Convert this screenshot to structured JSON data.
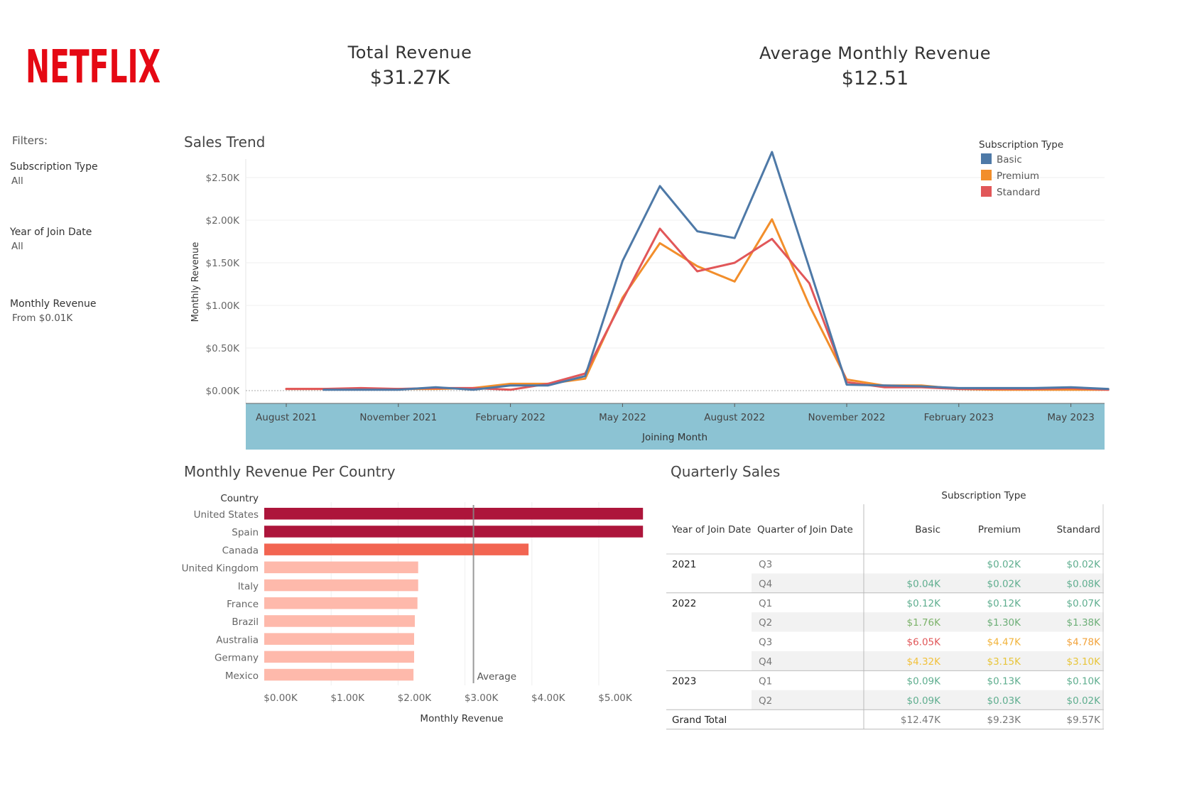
{
  "brand": {
    "logo_text": "NETFLIX",
    "color": "#e50914"
  },
  "kpis": [
    {
      "title": "Total Revenue",
      "value": "$31.27K"
    },
    {
      "title": "Average Monthly Revenue",
      "value": "$12.51"
    }
  ],
  "filters": {
    "heading": "Filters:",
    "items": [
      {
        "name": "Subscription Type",
        "value": "All"
      },
      {
        "name": "Year of Join Date",
        "value": "All"
      },
      {
        "name": "Monthly Revenue",
        "value": "From $0.01K"
      }
    ]
  },
  "colors": {
    "basic": "#4e79a7",
    "premium": "#f28e2b",
    "standard": "#e15759",
    "axis_band": "#8cc3d3"
  },
  "chart_data": [
    {
      "type": "line",
      "title": "Sales Trend",
      "xlabel": "Joining Month",
      "ylabel": "Monthly Revenue",
      "ylim": [
        0,
        2750
      ],
      "yticks": [
        0,
        500,
        1000,
        1500,
        2000,
        2500
      ],
      "ytick_labels": [
        "$0.00K",
        "$0.50K",
        "$1.00K",
        "$1.50K",
        "$2.00K",
        "$2.50K"
      ],
      "xtick_labels": [
        "August 2021",
        "November 2021",
        "February 2022",
        "May 2022",
        "August 2022",
        "November 2022",
        "February 2023",
        "May 2023"
      ],
      "xtick_months": [
        "2021-08",
        "2021-11",
        "2022-02",
        "2022-05",
        "2022-08",
        "2022-11",
        "2023-02",
        "2023-05"
      ],
      "legend_title": "Subscription Type",
      "legend_position": "top-right",
      "x": [
        "2021-08",
        "2021-09",
        "2021-10",
        "2021-11",
        "2021-12",
        "2022-01",
        "2022-02",
        "2022-03",
        "2022-04",
        "2022-05",
        "2022-06",
        "2022-07",
        "2022-08",
        "2022-09",
        "2022-10",
        "2022-11",
        "2022-12",
        "2023-01",
        "2023-02",
        "2023-03",
        "2023-04",
        "2023-05",
        "2023-06"
      ],
      "series": [
        {
          "name": "Basic",
          "color": "#4e79a7",
          "values": [
            null,
            10,
            10,
            10,
            40,
            10,
            60,
            60,
            170,
            1520,
            2400,
            1870,
            1790,
            2800,
            1440,
            70,
            60,
            50,
            30,
            30,
            30,
            40,
            20
          ]
        },
        {
          "name": "Premium",
          "color": "#f28e2b",
          "values": [
            20,
            20,
            20,
            20,
            20,
            30,
            80,
            80,
            140,
            1090,
            1730,
            1460,
            1280,
            2010,
            1000,
            130,
            60,
            60,
            20,
            10,
            10,
            10,
            10
          ]
        },
        {
          "name": "Standard",
          "color": "#e15759",
          "values": [
            20,
            20,
            30,
            20,
            30,
            30,
            10,
            80,
            200,
            1060,
            1900,
            1400,
            1500,
            1780,
            1260,
            100,
            40,
            40,
            20,
            20,
            20,
            30,
            10
          ]
        }
      ]
    },
    {
      "type": "bar",
      "orientation": "horizontal",
      "title": "Monthly Revenue Per Country",
      "ylabel": "Country",
      "xlabel": "Monthly Revenue",
      "xlim": [
        0,
        5800
      ],
      "xticks": [
        0,
        1000,
        2000,
        3000,
        4000,
        5000
      ],
      "xtick_labels": [
        "$0.00K",
        "$1.00K",
        "$2.00K",
        "$3.00K",
        "$4.00K",
        "$5.00K"
      ],
      "categories": [
        "United States",
        "Spain",
        "Canada",
        "United Kingdom",
        "Italy",
        "France",
        "Brazil",
        "Australia",
        "Germany",
        "Mexico"
      ],
      "values": [
        5660,
        5660,
        3950,
        2300,
        2300,
        2290,
        2250,
        2240,
        2240,
        2230
      ],
      "colors": [
        "#ad153b",
        "#ad153b",
        "#f26552",
        "#feb9ab",
        "#feb9ab",
        "#feb9ab",
        "#feb9ab",
        "#feb9ab",
        "#feb9ab",
        "#feb9ab"
      ],
      "reference_line": {
        "label": "Average",
        "value": 3127
      }
    },
    {
      "type": "table",
      "title": "Quarterly Sales",
      "column_group": "Subscription Type",
      "headers": [
        "Year of Join Date",
        "Quarter of Join Date",
        "Basic",
        "Premium",
        "Standard"
      ],
      "groups": [
        {
          "year": "2021",
          "rows": [
            {
              "quarter": "Q3",
              "cells": [
                {
                  "text": "",
                  "color": ""
                },
                {
                  "text": "$0.02K",
                  "color": "#5fae8f"
                },
                {
                  "text": "$0.02K",
                  "color": "#5fae8f"
                }
              ]
            },
            {
              "quarter": "Q4",
              "cells": [
                {
                  "text": "$0.04K",
                  "color": "#5fae8f"
                },
                {
                  "text": "$0.02K",
                  "color": "#5fae8f"
                },
                {
                  "text": "$0.08K",
                  "color": "#5fae8f"
                }
              ]
            }
          ]
        },
        {
          "year": "2022",
          "rows": [
            {
              "quarter": "Q1",
              "cells": [
                {
                  "text": "$0.12K",
                  "color": "#5fae8f"
                },
                {
                  "text": "$0.12K",
                  "color": "#5fae8f"
                },
                {
                  "text": "$0.07K",
                  "color": "#5fae8f"
                }
              ]
            },
            {
              "quarter": "Q2",
              "cells": [
                {
                  "text": "$1.76K",
                  "color": "#7cb36a"
                },
                {
                  "text": "$1.30K",
                  "color": "#6daf78"
                },
                {
                  "text": "$1.38K",
                  "color": "#6daf78"
                }
              ]
            },
            {
              "quarter": "Q3",
              "cells": [
                {
                  "text": "$6.05K",
                  "color": "#e15759"
                },
                {
                  "text": "$4.47K",
                  "color": "#f2b43c"
                },
                {
                  "text": "$4.78K",
                  "color": "#f2a33c"
                }
              ]
            },
            {
              "quarter": "Q4",
              "cells": [
                {
                  "text": "$4.32K",
                  "color": "#f2c13c"
                },
                {
                  "text": "$3.15K",
                  "color": "#e8c53a"
                },
                {
                  "text": "$3.10K",
                  "color": "#e8c53a"
                }
              ]
            }
          ]
        },
        {
          "year": "2023",
          "rows": [
            {
              "quarter": "Q1",
              "cells": [
                {
                  "text": "$0.09K",
                  "color": "#5fae8f"
                },
                {
                  "text": "$0.13K",
                  "color": "#5fae8f"
                },
                {
                  "text": "$0.10K",
                  "color": "#5fae8f"
                }
              ]
            },
            {
              "quarter": "Q2",
              "cells": [
                {
                  "text": "$0.09K",
                  "color": "#5fae8f"
                },
                {
                  "text": "$0.03K",
                  "color": "#5fae8f"
                },
                {
                  "text": "$0.02K",
                  "color": "#5fae8f"
                }
              ]
            }
          ]
        }
      ],
      "total": {
        "label": "Grand Total",
        "cells": [
          "$12.47K",
          "$9.23K",
          "$9.57K"
        ]
      }
    }
  ]
}
